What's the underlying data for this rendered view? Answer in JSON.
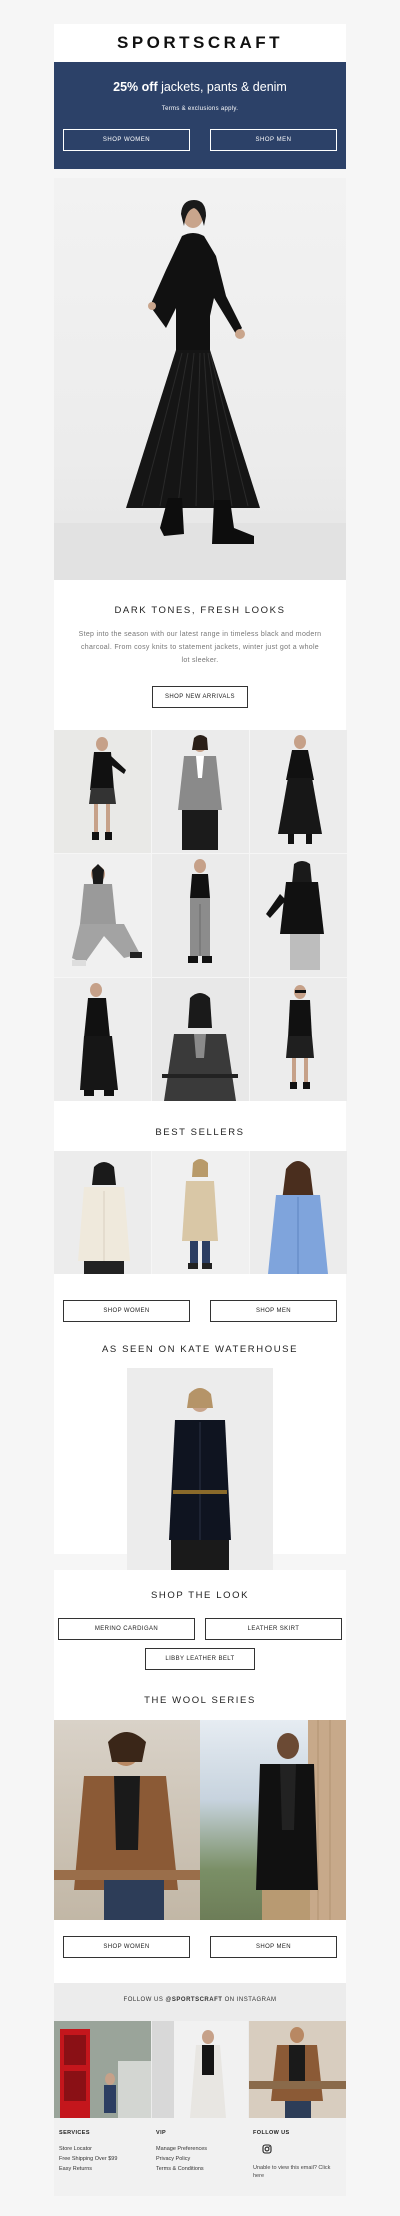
{
  "brand": {
    "name": "SPORTSCRAFT"
  },
  "promo": {
    "headline_bold": "25% off",
    "headline_rest": " jackets, pants & denim",
    "terms": "Terms & exclusions apply.",
    "buttons": [
      "SHOP WOMEN",
      "SHOP MEN"
    ],
    "bg_color": "#2c4168"
  },
  "intro": {
    "title": "DARK TONES, FRESH LOOKS",
    "body": "Step into the season with our latest range in timeless black and modern charcoal. From cosy knits to statement jackets, winter just got a whole lot sleeker.",
    "button": "SHOP NEW ARRIVALS"
  },
  "bestsellers": {
    "title": "BEST SELLERS",
    "buttons": [
      "SHOP WOMEN",
      "SHOP MEN"
    ]
  },
  "kate": {
    "title": "AS SEEN ON KATE WATERHOUSE"
  },
  "shop_look": {
    "title": "SHOP THE LOOK",
    "items": [
      "MERINO CARDIGAN",
      "LEATHER SKIRT",
      "LIBBY LEATHER BELT"
    ]
  },
  "wool": {
    "title": "THE WOOL SERIES",
    "buttons": [
      "SHOP WOMEN",
      "SHOP MEN"
    ]
  },
  "instagram": {
    "prefix": "FOLLOW US ",
    "handle": "@SPORTSCRAFT",
    "suffix": " ON INSTAGRAM"
  },
  "footer": {
    "services": {
      "title": "SERVICES",
      "links": [
        "Store Locator",
        "Free Shipping Over $99",
        "Easy Returns"
      ]
    },
    "vip": {
      "title": "VIP",
      "links": [
        "Manage Preferences",
        "Privacy Policy",
        "Terms & Conditions"
      ]
    },
    "follow": {
      "title": "FOLLOW US",
      "note": "Unable to view this email? Click here"
    }
  }
}
